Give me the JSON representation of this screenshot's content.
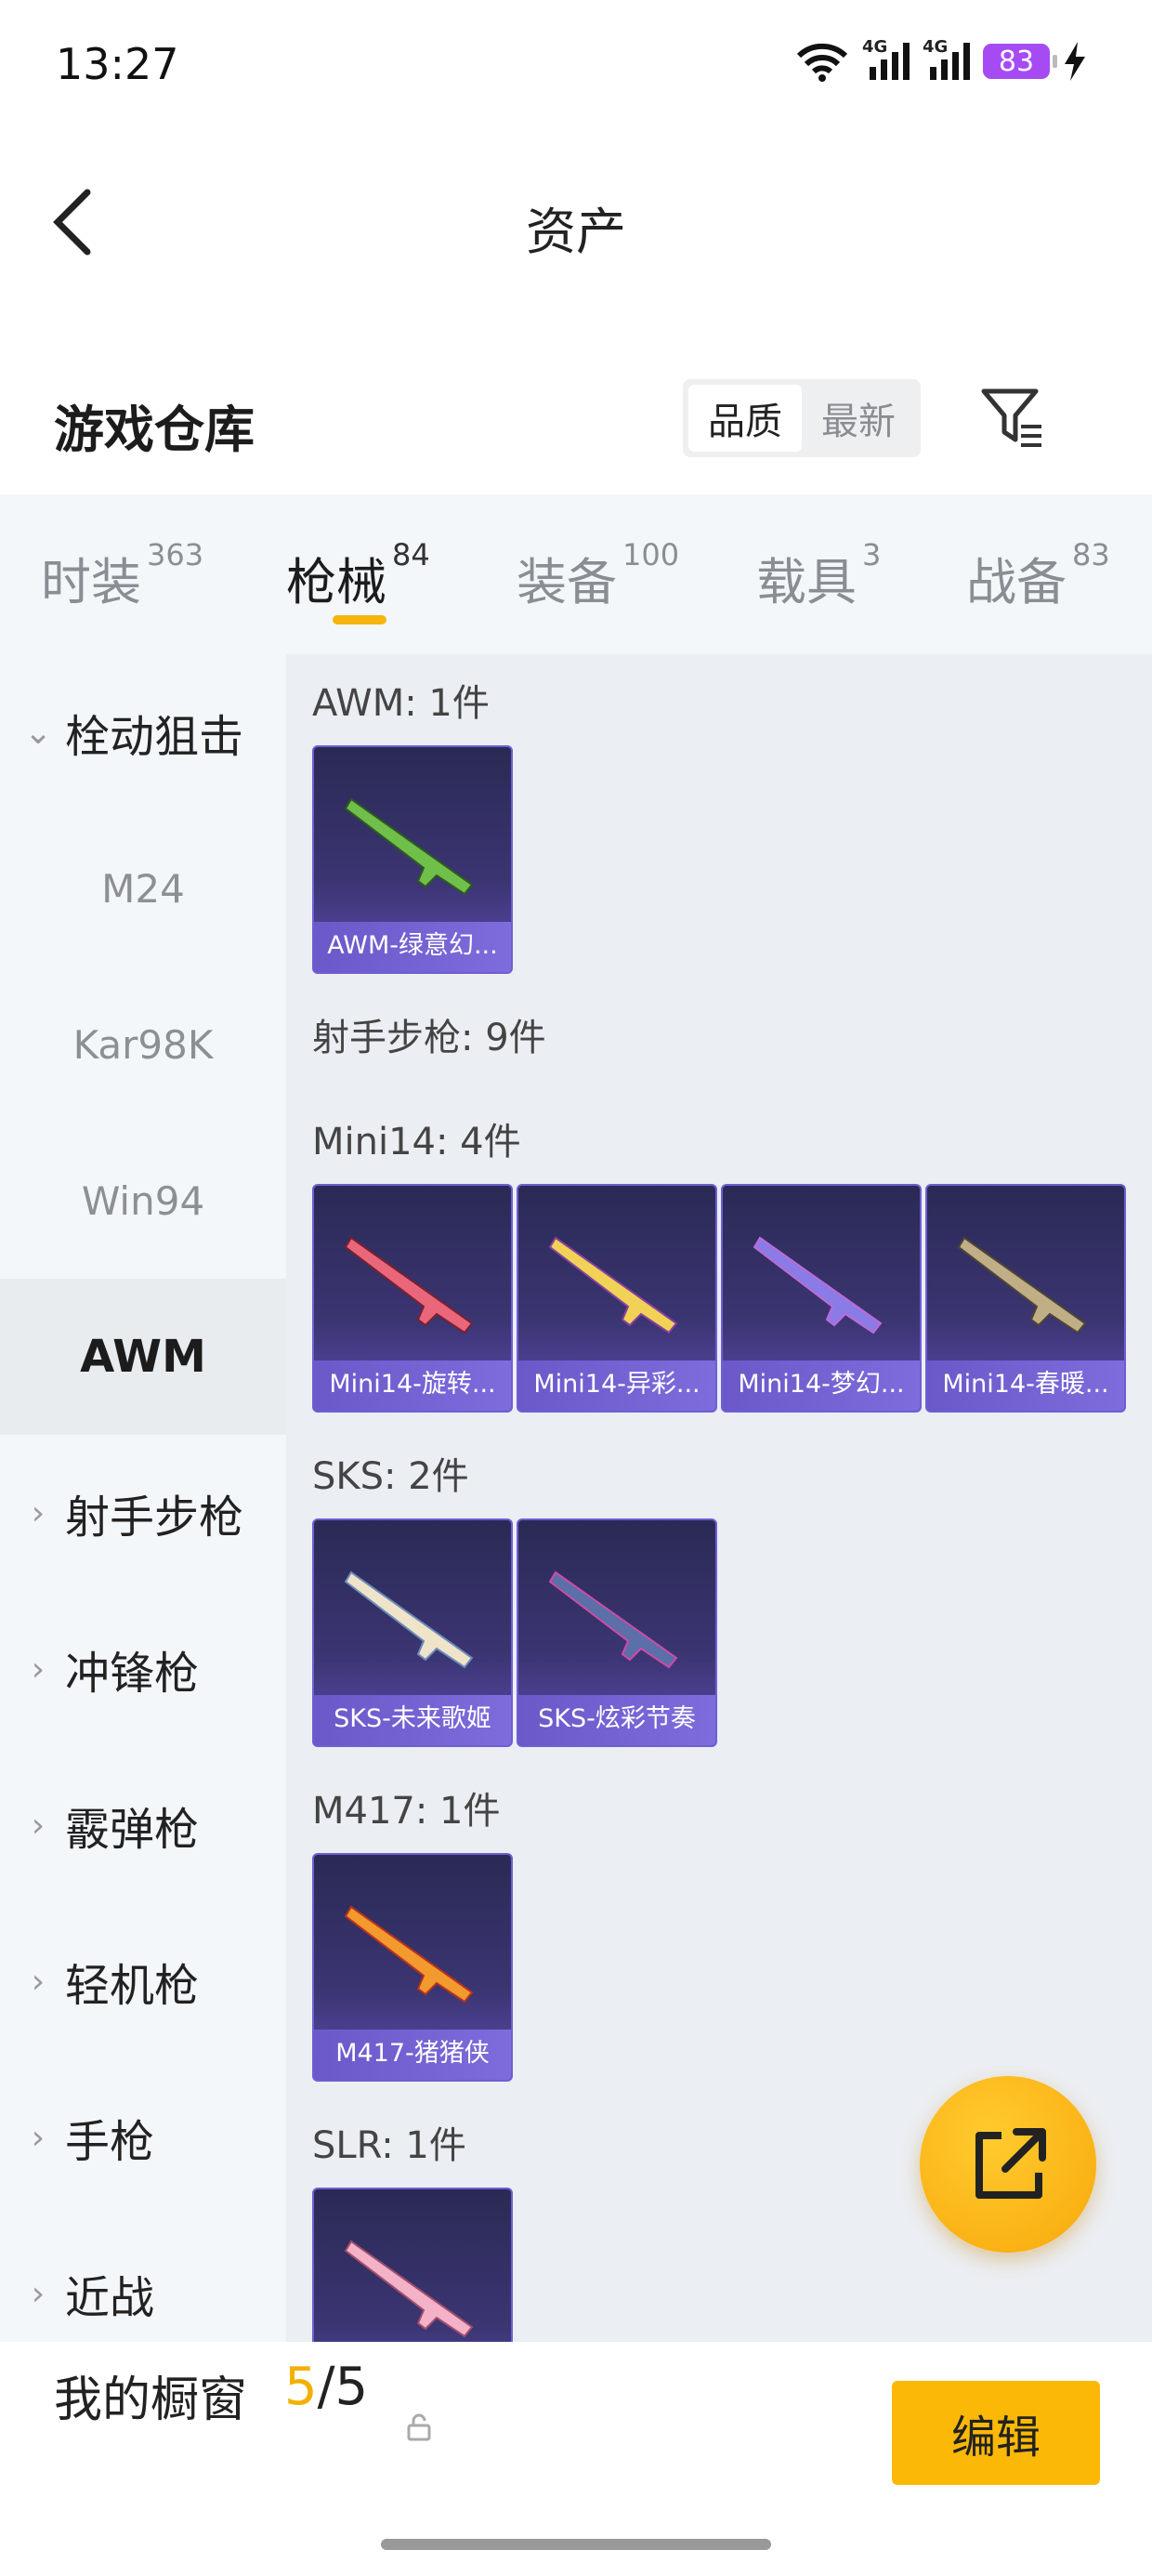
{
  "status_bar": {
    "time": "13:27",
    "network_1": "4G",
    "network_2": "4G",
    "battery": "83"
  },
  "nav": {
    "title": "资产"
  },
  "header": {
    "title": "游戏仓库",
    "sort_quality": "品质",
    "sort_newest": "最新"
  },
  "tabs": [
    {
      "label": "时装",
      "count": "363"
    },
    {
      "label": "枪械",
      "count": "84"
    },
    {
      "label": "装备",
      "count": "100"
    },
    {
      "label": "载具",
      "count": "3"
    },
    {
      "label": "战备",
      "count": "83"
    }
  ],
  "sidebar": {
    "expanded_category": "栓动狙击",
    "sub_items": [
      "M24",
      "Kar98K",
      "Win94",
      "AWM"
    ],
    "categories": [
      "射手步枪",
      "冲锋枪",
      "霰弹枪",
      "轻机枪",
      "手枪",
      "近战"
    ]
  },
  "groups": [
    {
      "label": "AWM: 1件",
      "items": [
        "AWM-绿意幻..."
      ]
    },
    {
      "label": "射手步枪: 9件",
      "items": []
    },
    {
      "label": "Mini14: 4件",
      "items": [
        "Mini14-旋转...",
        "Mini14-异彩...",
        "Mini14-梦幻...",
        "Mini14-春暖..."
      ]
    },
    {
      "label": "SKS: 2件",
      "items": [
        "SKS-未来歌姬",
        "SKS-炫彩节奏"
      ]
    },
    {
      "label": "M417: 1件",
      "items": [
        "M417-猪猪侠"
      ]
    },
    {
      "label": "SLR: 1件",
      "items": [
        ""
      ]
    }
  ],
  "bottom": {
    "showcase_label": "我的橱窗",
    "showcase_used": "5",
    "showcase_total": "/5",
    "edit_label": "编辑"
  },
  "colors": {
    "accent": "#fbb806",
    "card_bg": "#3b3572",
    "battery": "#a64bf4"
  }
}
